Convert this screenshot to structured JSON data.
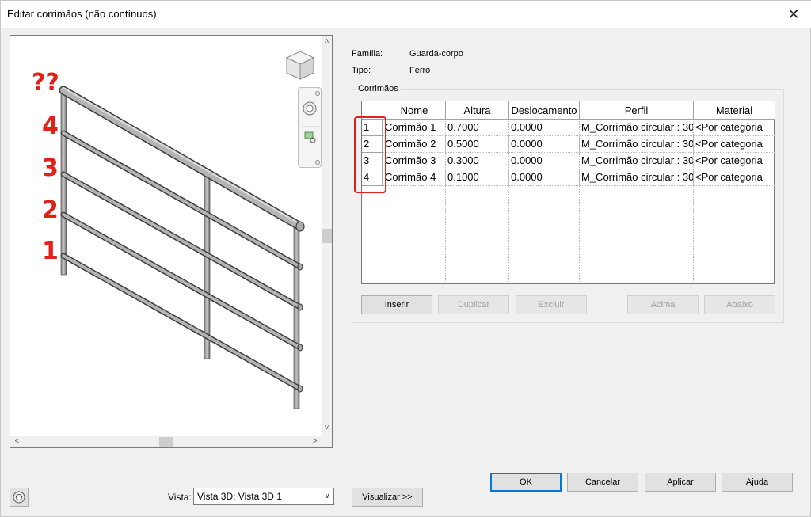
{
  "window": {
    "title": "Editar corrimãos (não contínuos)",
    "close": "✕"
  },
  "preview": {
    "annotations": [
      "??",
      "4",
      "3",
      "2",
      "1"
    ],
    "viewcube_icon": "viewcube-icon",
    "scroll_up": "˄",
    "scroll_down": "˅",
    "scroll_left": "<",
    "scroll_right": ">"
  },
  "info": {
    "familia_label": "Família:",
    "familia_value": "Guarda-corpo",
    "tipo_label": "Tipo:",
    "tipo_value": "Ferro"
  },
  "group_title": "Corrimãos",
  "table": {
    "columns": [
      "Nome",
      "Altura",
      "Deslocamento",
      "Perfil",
      "Material"
    ],
    "rows": [
      {
        "index": "1",
        "nome": "Corrimão 1",
        "altura": "0.7000",
        "deslocamento": "0.0000",
        "perfil": "M_Corrimão circular : 30",
        "material": "<Por categoria"
      },
      {
        "index": "2",
        "nome": "Corrimão 2",
        "altura": "0.5000",
        "deslocamento": "0.0000",
        "perfil": "M_Corrimão circular : 30",
        "material": "<Por categoria"
      },
      {
        "index": "3",
        "nome": "Corrimão 3",
        "altura": "0.3000",
        "deslocamento": "0.0000",
        "perfil": "M_Corrimão circular : 30",
        "material": "<Por categoria"
      },
      {
        "index": "4",
        "nome": "Corrimão 4",
        "altura": "0.1000",
        "deslocamento": "0.0000",
        "perfil": "M_Corrimão circular : 30",
        "material": "<Por categoria"
      }
    ]
  },
  "grid_buttons": {
    "inserir": "Inserir",
    "duplicar": "Duplicar",
    "excluir": "Excluir",
    "acima": "Acima",
    "abaixo": "Abaixo"
  },
  "footer": {
    "vista_label": "Vista:",
    "vista_value": "Vista 3D: Vista 3D 1",
    "visualizar": "Visualizar >>",
    "ok": "OK",
    "cancelar": "Cancelar",
    "aplicar": "Aplicar",
    "ajuda": "Ajuda"
  },
  "colors": {
    "annotation_red": "#e0211a",
    "default_button_border": "#0078d7"
  }
}
